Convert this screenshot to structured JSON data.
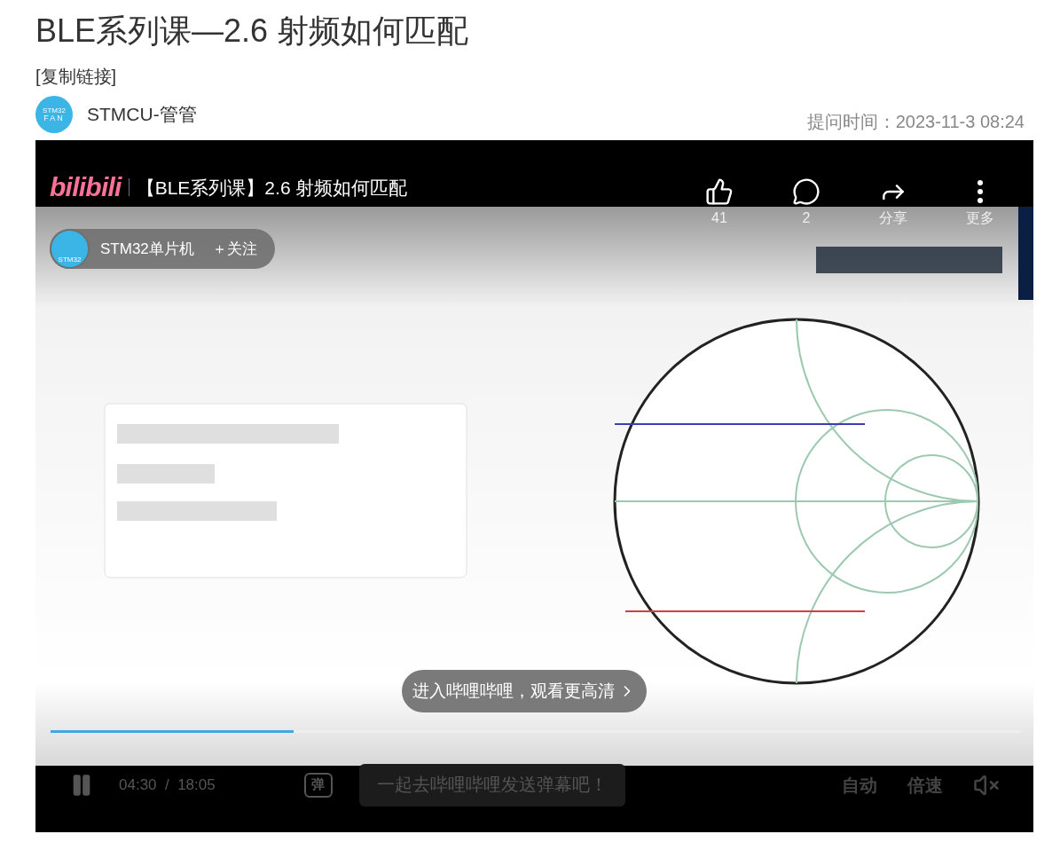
{
  "title": "BLE系列课—2.6 射频如何匹配",
  "copy_link": "[复制链接]",
  "author": {
    "name": "STMCU-管管",
    "avatar_text": [
      "STM32",
      "FAN"
    ]
  },
  "asked_time": "提问时间：2023-11-3 08:24",
  "player": {
    "brand": "bilibili",
    "video_title": "【BLE系列课】2.6 射频如何匹配",
    "actions": [
      {
        "kind": "like",
        "label": "41"
      },
      {
        "kind": "comment",
        "label": "2"
      },
      {
        "kind": "share",
        "label": "分享"
      },
      {
        "kind": "more",
        "label": "更多"
      }
    ],
    "channel": {
      "avatar_text": "STM32",
      "name": "STM32单片机",
      "follow": "＋关注"
    },
    "open_prompt": "进入哔哩哔哩，观看更高清",
    "progress": {
      "level": 0.25
    },
    "playing": true,
    "time": "04:30  /  18:05",
    "danmaku_icon": "弹",
    "danmaku_placeholder": "一起去哔哩哔哩发送弹幕吧！",
    "buttons": [
      "自动",
      "倍速"
    ],
    "muted": true
  }
}
